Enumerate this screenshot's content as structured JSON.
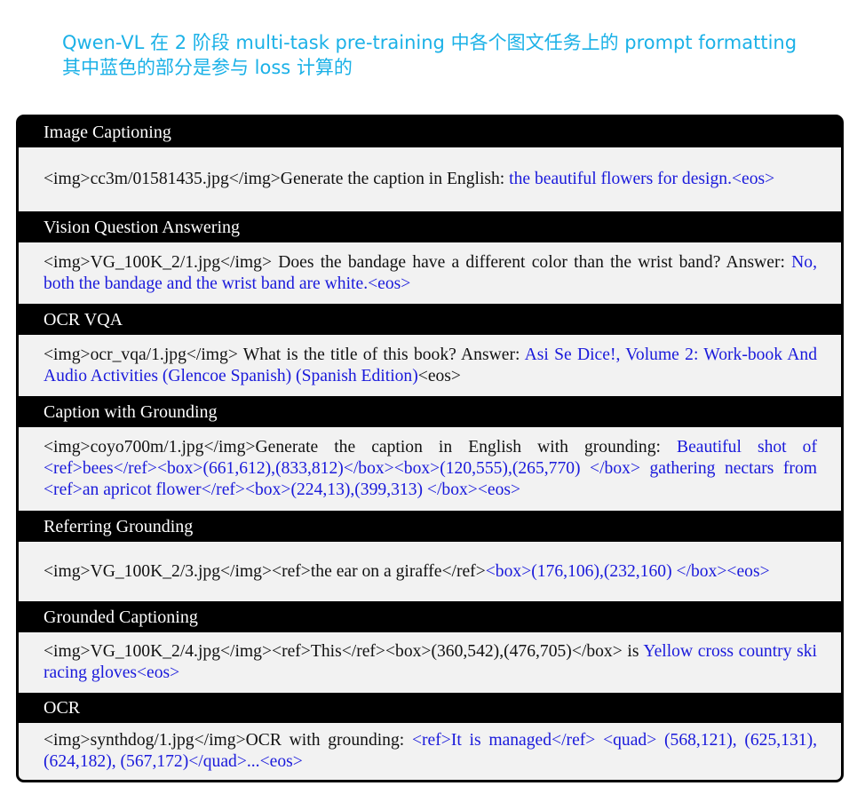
{
  "title": {
    "line1": "Qwen-VL 在 2 阶段 multi-task pre-training 中各个图文任务上的 prompt formatting",
    "line2": "其中蓝色的部分是参与 loss 计算的"
  },
  "colors": {
    "title": "#1bb1e7",
    "loss_text": "#1a1adb",
    "header_bg": "#000000",
    "row_bg": "#f2f2f2"
  },
  "tasks": [
    {
      "name": "Image Captioning",
      "prompt": "<img>cc3m/01581435.jpg</img>Generate the caption in English: ",
      "target": "the beautiful flowers for design.<eos>",
      "suffix": ""
    },
    {
      "name": "Vision Question Answering",
      "prompt": "<img>VG_100K_2/1.jpg</img> Does the bandage have a different color than the wrist band? Answer: ",
      "target": "No, both the bandage and the wrist band are white.<eos>",
      "suffix": ""
    },
    {
      "name": "OCR VQA",
      "prompt": "<img>ocr_vqa/1.jpg</img> What is the title of this book? Answer: ",
      "target": "Asi Se Dice!, Volume 2: Work-book And Audio Activities (Glencoe Spanish) (Spanish Edition)",
      "suffix": "<eos>"
    },
    {
      "name": "Caption with Grounding",
      "prompt": "<img>coyo700m/1.jpg</img>Generate the caption in English with grounding: ",
      "target": "Beautiful shot of <ref>bees</ref><box>(661,612),(833,812)</box><box>(120,555),(265,770) </box> gathering nectars from <ref>an apricot flower</ref><box>(224,13),(399,313) </box><eos>",
      "suffix": ""
    },
    {
      "name": "Referring Grounding",
      "prompt": "<img>VG_100K_2/3.jpg</img><ref>the ear on a giraffe</ref>",
      "target": "<box>(176,106),(232,160) </box><eos>",
      "suffix": ""
    },
    {
      "name": "Grounded Captioning",
      "prompt": "<img>VG_100K_2/4.jpg</img><ref>This</ref><box>(360,542),(476,705)</box> is ",
      "target": "Yellow cross country ski racing gloves<eos>",
      "suffix": ""
    },
    {
      "name": "OCR",
      "prompt": "<img>synthdog/1.jpg</img>OCR with grounding: ",
      "target": "<ref>It is managed</ref> <quad> (568,121), (625,131), (624,182), (567,172)</quad>...<eos>",
      "suffix": ""
    }
  ]
}
